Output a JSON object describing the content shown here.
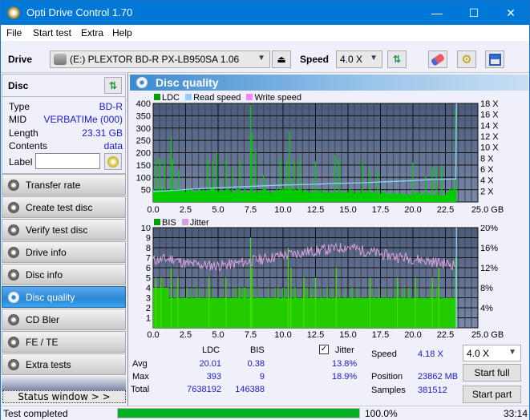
{
  "app": {
    "title": "Opti Drive Control 1.70",
    "controls": {
      "minimize": "—",
      "maximize": "☐",
      "close": "✕"
    }
  },
  "menu": [
    "File",
    "Start test",
    "Extra",
    "Help"
  ],
  "toolbar": {
    "drive_label": "Drive",
    "drive_value": "(E:)  PLEXTOR BD-R  PX-LB950SA 1.06",
    "speed_label": "Speed",
    "speed_value": "4.0 X"
  },
  "disc": {
    "title": "Disc",
    "rows": [
      {
        "k": "Type",
        "v": "BD-R"
      },
      {
        "k": "MID",
        "v": "VERBATIMe (000)"
      },
      {
        "k": "Length",
        "v": "23.31 GB"
      },
      {
        "k": "Contents",
        "v": "data"
      }
    ],
    "label_label": "Label",
    "label_value": ""
  },
  "nav": [
    {
      "label": "Transfer rate"
    },
    {
      "label": "Create test disc"
    },
    {
      "label": "Verify test disc"
    },
    {
      "label": "Drive info"
    },
    {
      "label": "Disc info"
    },
    {
      "label": "Disc quality",
      "active": true
    },
    {
      "label": "CD Bler"
    },
    {
      "label": "FE / TE"
    },
    {
      "label": "Extra tests"
    }
  ],
  "status_window": "Status window > >",
  "panel": {
    "title": "Disc quality"
  },
  "colors": {
    "ldc": "#00a000",
    "bis": "#00a000",
    "read": "#8ecfff",
    "write": "#ff80ff",
    "jitter": "#d8a0d8",
    "plot_bg_top": "#4a5a7a",
    "plot_bg_bottom": "#7888a8",
    "bar": "#00cc00",
    "accent": "#0078d7"
  },
  "chart_data": [
    {
      "type": "bar",
      "title": "LDC",
      "legend": [
        "LDC",
        "Read speed",
        "Write speed"
      ],
      "legend_position": "top-left",
      "xlabel": "GB",
      "xlim": [
        0,
        25
      ],
      "ylim": [
        0,
        400
      ],
      "y2lim": [
        0,
        18
      ],
      "xticks": [
        "0.0",
        "2.5",
        "5.0",
        "7.5",
        "10.0",
        "12.5",
        "15.0",
        "17.5",
        "20.0",
        "22.5",
        "25.0 GB"
      ],
      "yticks": [
        "50",
        "100",
        "150",
        "200",
        "250",
        "300",
        "350",
        "400"
      ],
      "y2ticks": [
        "2 X",
        "4 X",
        "6 X",
        "8 X",
        "10 X",
        "12 X",
        "14 X",
        "16 X",
        "18 X"
      ],
      "ldc_baseline": [
        [
          0,
          60
        ],
        [
          5,
          55
        ],
        [
          10,
          55
        ],
        [
          15,
          50
        ],
        [
          20,
          40
        ],
        [
          22.5,
          40
        ],
        [
          23.3,
          70
        ]
      ],
      "ldc_spikes": [
        [
          0.2,
          175
        ],
        [
          0.5,
          180
        ],
        [
          0.9,
          175
        ],
        [
          1.4,
          265
        ],
        [
          1.5,
          175
        ],
        [
          2.0,
          130
        ],
        [
          4.2,
          175
        ],
        [
          4.6,
          165
        ],
        [
          4.9,
          200
        ],
        [
          5.6,
          170
        ],
        [
          6.1,
          140
        ],
        [
          6.7,
          170
        ],
        [
          7.5,
          395
        ],
        [
          7.6,
          275
        ],
        [
          7.9,
          205
        ],
        [
          8.5,
          110
        ],
        [
          9.8,
          175
        ],
        [
          10.3,
          170
        ],
        [
          10.5,
          290
        ],
        [
          10.9,
          170
        ],
        [
          11.3,
          170
        ],
        [
          12.5,
          165
        ],
        [
          14.0,
          190
        ],
        [
          14.3,
          170
        ],
        [
          16.1,
          170
        ],
        [
          16.7,
          130
        ],
        [
          17.3,
          130
        ],
        [
          20.0,
          160
        ],
        [
          21.0,
          105
        ],
        [
          21.5,
          140
        ],
        [
          21.8,
          140
        ],
        [
          22.2,
          150
        ],
        [
          23.3,
          380
        ]
      ],
      "read_speed": [
        [
          0,
          1.9
        ],
        [
          2,
          2.2
        ],
        [
          4,
          2.5
        ],
        [
          6,
          2.7
        ],
        [
          8,
          2.9
        ],
        [
          10,
          3.1
        ],
        [
          12,
          3.2
        ],
        [
          14,
          3.4
        ],
        [
          16,
          3.5
        ],
        [
          18,
          3.7
        ],
        [
          20,
          3.9
        ],
        [
          21.4,
          4.1
        ],
        [
          23.3,
          4.2
        ],
        [
          23.35,
          18
        ]
      ]
    },
    {
      "type": "bar",
      "title": "BIS",
      "legend": [
        "BIS",
        "Jitter"
      ],
      "legend_position": "top-left",
      "xlabel": "GB",
      "xlim": [
        0,
        25
      ],
      "ylim": [
        0,
        10
      ],
      "y2lim": [
        0,
        20
      ],
      "xticks": [
        "0.0",
        "2.5",
        "5.0",
        "7.5",
        "10.0",
        "12.5",
        "15.0",
        "17.5",
        "20.0",
        "22.5",
        "25.0 GB"
      ],
      "yticks": [
        "1",
        "2",
        "3",
        "4",
        "5",
        "6",
        "7",
        "8",
        "9",
        "10"
      ],
      "y2ticks": [
        "4%",
        "8%",
        "12%",
        "16%",
        "20%"
      ],
      "bis_level": [
        [
          0,
          4
        ],
        [
          1.2,
          3
        ],
        [
          23.3,
          3
        ]
      ],
      "bis_spikes": [
        [
          0.2,
          5
        ],
        [
          0.6,
          5
        ],
        [
          1.4,
          6
        ],
        [
          1.9,
          5
        ],
        [
          4.3,
          5
        ],
        [
          5.6,
          5
        ],
        [
          7.5,
          9
        ],
        [
          7.6,
          6
        ],
        [
          10.4,
          8
        ],
        [
          10.6,
          6
        ],
        [
          11.6,
          5
        ],
        [
          12.5,
          5
        ],
        [
          14.1,
          6
        ],
        [
          16.7,
          5
        ],
        [
          18.8,
          5
        ],
        [
          20.2,
          5
        ],
        [
          21.5,
          5
        ],
        [
          22.0,
          6
        ],
        [
          23.3,
          7
        ]
      ],
      "jitter_pct": [
        [
          0,
          13.5
        ],
        [
          1.5,
          13.8
        ],
        [
          2.5,
          12.8
        ],
        [
          4,
          12.5
        ],
        [
          5,
          12.4
        ],
        [
          6,
          12.7
        ],
        [
          7.5,
          13.3
        ],
        [
          9,
          14.0
        ],
        [
          10,
          14.5
        ],
        [
          12,
          15.2
        ],
        [
          14,
          15.8
        ],
        [
          15,
          16.2
        ],
        [
          16,
          15.5
        ],
        [
          18,
          14.5
        ],
        [
          20,
          13.8
        ],
        [
          22,
          13.0
        ],
        [
          23.2,
          12.6
        ]
      ]
    }
  ],
  "stats": {
    "headers": [
      "LDC",
      "BIS"
    ],
    "rows": [
      {
        "label": "Avg",
        "ldc": "20.01",
        "bis": "0.38",
        "jitter": "13.8%"
      },
      {
        "label": "Max",
        "ldc": "393",
        "bis": "9",
        "jitter": "18.9%"
      },
      {
        "label": "Total",
        "ldc": "7638192",
        "bis": "146388"
      }
    ],
    "jitter_label": "Jitter",
    "jitter_checked": true,
    "speed_label": "Speed",
    "speed_value": "4.18 X",
    "position_label": "Position",
    "position_value": "23862 MB",
    "samples_label": "Samples",
    "samples_value": "381512",
    "speed_select": "4.0 X",
    "start_full": "Start full",
    "start_part": "Start part"
  },
  "statusbar": {
    "text": "Test completed",
    "progress": 1.0,
    "percent": "100.0%",
    "time": "33:14"
  }
}
